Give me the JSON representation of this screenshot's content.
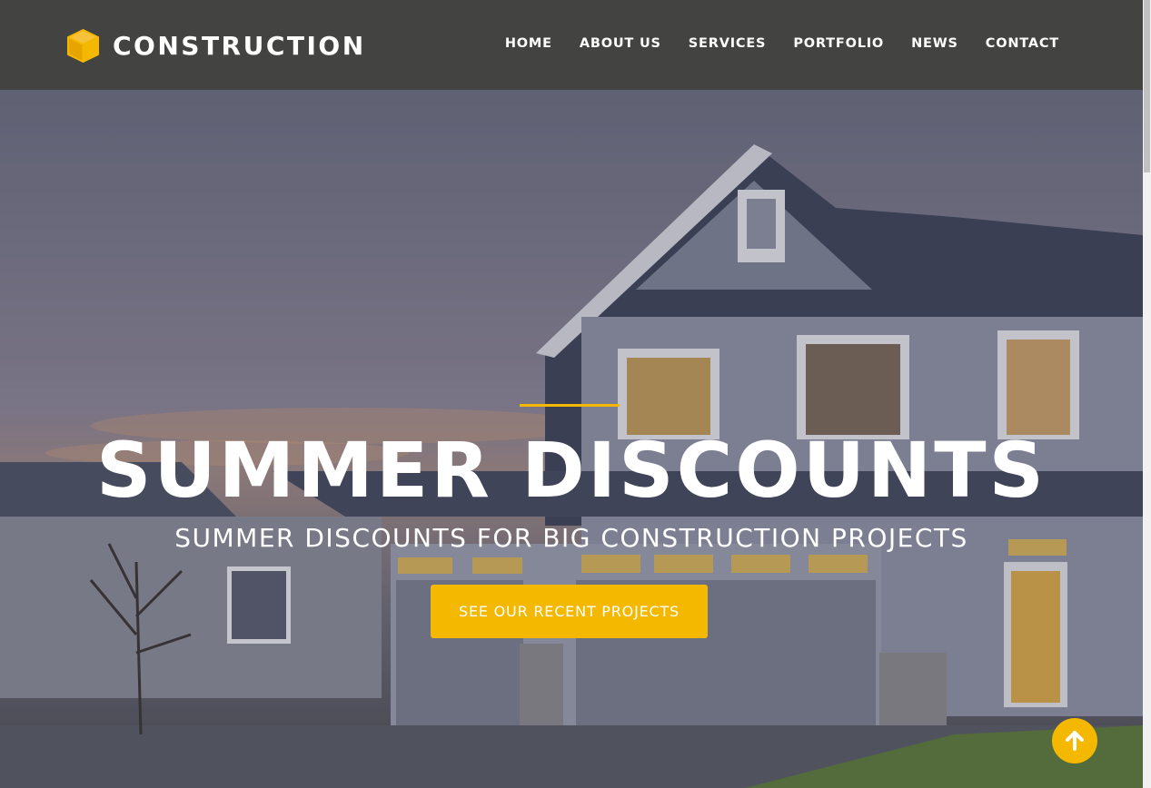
{
  "brand": {
    "name": "CONSTRUCTION",
    "accent_color": "#f5b800",
    "icon": "cube-icon"
  },
  "nav": {
    "items": [
      {
        "label": "HOME"
      },
      {
        "label": "ABOUT US"
      },
      {
        "label": "SERVICES"
      },
      {
        "label": "PORTFOLIO"
      },
      {
        "label": "NEWS"
      },
      {
        "label": "CONTACT"
      }
    ]
  },
  "hero": {
    "title": "SUMMER DISCOUNTS",
    "subtitle": "SUMMER DISCOUNTS FOR BIG CONSTRUCTION PROJECTS",
    "cta_label": "SEE OUR RECENT PROJECTS",
    "background_image": "house-photo"
  },
  "scroll_top": {
    "icon": "arrow-up-icon"
  }
}
